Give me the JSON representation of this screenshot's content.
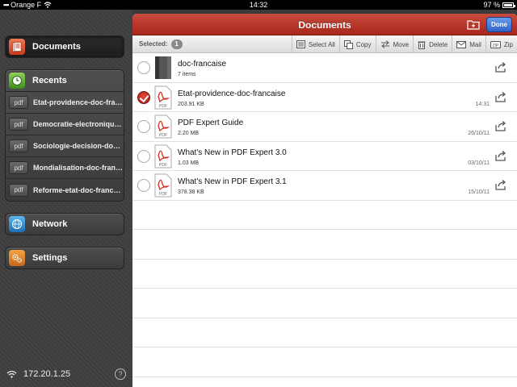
{
  "status": {
    "carrier": "Orange F",
    "time": "14:32",
    "battery": "97 %"
  },
  "sidebar": {
    "documents_label": "Documents",
    "recents_label": "Recents",
    "recents": [
      {
        "badge": "pdf",
        "title": "Etat-providence-doc-francaise"
      },
      {
        "badge": "pdf",
        "title": "Democratie-electronique-doc-francaise"
      },
      {
        "badge": "pdf",
        "title": "Sociologie-decision-doc-francaise"
      },
      {
        "badge": "pdf",
        "title": "Mondialisation-doc-francaise"
      },
      {
        "badge": "pdf",
        "title": "Reforme-etat-doc-francaise"
      }
    ],
    "network_label": "Network",
    "settings_label": "Settings",
    "ip_address": "172.20.1.25",
    "help_label": "?"
  },
  "header": {
    "title": "Documents",
    "done_label": "Done"
  },
  "toolbar": {
    "selected_label": "Selected:",
    "selected_count": "1",
    "select_all": "Select All",
    "copy": "Copy",
    "move": "Move",
    "delete": "Delete",
    "mail": "Mail",
    "zip": "Zip"
  },
  "files": [
    {
      "name": "doc-francaise",
      "sub": "7 items",
      "date": "",
      "type": "folder",
      "selected": false
    },
    {
      "name": "Etat-providence-doc-francaise",
      "sub": "203.91 KB",
      "date": "14:31",
      "type": "pdf",
      "selected": true
    },
    {
      "name": "PDF Expert Guide",
      "sub": "2.20 MB",
      "date": "26/10/11",
      "type": "pdf",
      "selected": false
    },
    {
      "name": "What's New in PDF Expert 3.0",
      "sub": "1.03 MB",
      "date": "03/10/11",
      "type": "pdf",
      "selected": false
    },
    {
      "name": "What's New in PDF Expert 3.1",
      "sub": "378.38 KB",
      "date": "15/10/11",
      "type": "pdf",
      "selected": false
    }
  ],
  "pdf_thumb_label": "PDF",
  "colors": {
    "accent_red": "#b3322a",
    "done_blue": "#2f63c9"
  }
}
